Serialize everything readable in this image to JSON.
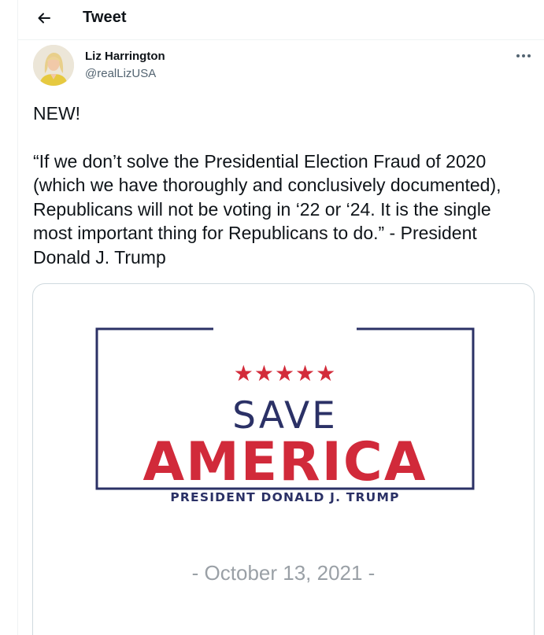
{
  "header": {
    "back_icon": "arrow-left-icon",
    "title": "Tweet"
  },
  "author": {
    "display_name": "Liz Harrington",
    "handle": "@realLizUSA"
  },
  "more_icon": "more-dots-icon",
  "tweet": {
    "line1": "NEW!",
    "quote": "“If we don’t solve the Presidential Election Fraud of 2020 (which we have thoroughly and conclusively documented), Republicans will not be voting in ‘22 or ‘24. It is the single most important thing for Republicans to do.” - President Donald J. Trump"
  },
  "media": {
    "stars": "★★★★★",
    "save": "SAVE",
    "america": "AMERICA",
    "president": "PRESIDENT DONALD J. TRUMP",
    "date": "- October 13, 2021 -",
    "colors": {
      "navy": "#2b3166",
      "red": "#d12a3a",
      "date_gray": "#9aa0a6"
    }
  }
}
